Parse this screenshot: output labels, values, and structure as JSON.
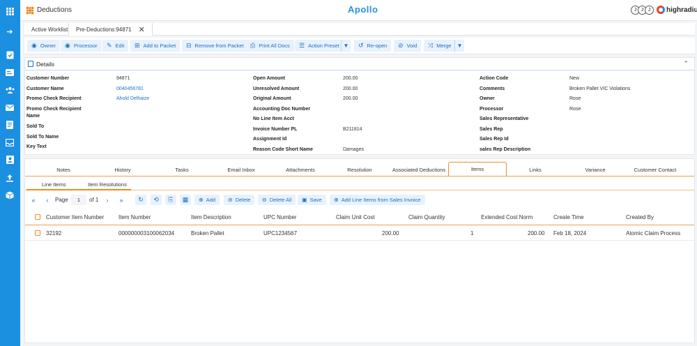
{
  "topbar": {
    "app_title": "Deductions",
    "brand": "Apollo",
    "avatars": [
      "J",
      "J",
      "J"
    ],
    "company": "highradius"
  },
  "sidebar": {
    "icons": [
      "grid-icon",
      "arrow-right-icon",
      "checklist-icon",
      "id-card-icon",
      "users-icon",
      "mail-icon",
      "document-icon",
      "inbox-icon",
      "contact-icon",
      "upload-icon",
      "box-icon"
    ]
  },
  "worklist_tabs": [
    {
      "label": "Active Worklist"
    },
    {
      "label": "Pre-Deductions:94871"
    }
  ],
  "toolbar": {
    "buttons": [
      "Owner",
      "Processor",
      "Edit",
      "Add to Packet",
      "Remove from Packet",
      "Print All Docs",
      "Action Preset",
      "Re-open",
      "Void",
      "Merge"
    ]
  },
  "details": {
    "title": "Details",
    "col1": [
      {
        "label": "Customer Number",
        "value": "94871"
      },
      {
        "label": "Customer Name",
        "value": "0040456781"
      },
      {
        "label": "Promo Check Recipient",
        "value": "Ahold Delhaize"
      },
      {
        "label": "Promo Check Recipient",
        "value": ""
      },
      {
        "label": "Name",
        "value": ""
      },
      {
        "label": "Sold To",
        "value": ""
      },
      {
        "label": "Sold To Name",
        "value": ""
      },
      {
        "label": "Key Text",
        "value": ""
      }
    ],
    "col2": [
      {
        "label": "Open Amount",
        "value": "200.00"
      },
      {
        "label": "Unresolved Amount",
        "value": "200.00"
      },
      {
        "label": "Original Amount",
        "value": "200.00"
      },
      {
        "label": "Accounting Doc Number",
        "value": ""
      },
      {
        "label": "No Line Item Acct",
        "value": ""
      },
      {
        "label": "Invoice Number PL",
        "value": "B211814"
      },
      {
        "label": "Assignment Id",
        "value": ""
      },
      {
        "label": "Reason Code Short Name",
        "value": "Damages"
      }
    ],
    "col3": [
      {
        "label": "Action Code",
        "value": "New"
      },
      {
        "label": "Comments",
        "value": "Broken Pallet VIC Violations"
      },
      {
        "label": "Owner",
        "value": "Rose"
      },
      {
        "label": "Processor",
        "value": "Rose"
      },
      {
        "label": "Sales Representative",
        "value": ""
      },
      {
        "label": "Sales Rep",
        "value": ""
      },
      {
        "label": "Sales Rep Id",
        "value": ""
      },
      {
        "label": "sales Rep Description",
        "value": ""
      }
    ]
  },
  "lower_tabs": [
    "Notes",
    "History",
    "Tasks",
    "Email Inbox",
    "Attachments",
    "Resolution",
    "Associated Deductions",
    "Items",
    "Links",
    "Variance",
    "Customer Contact"
  ],
  "active_lower_tab": "Items",
  "sub_tabs": [
    "Line Items",
    "Item Resolutions"
  ],
  "grid_toolbar": {
    "page_label": "Page",
    "page_value": "1",
    "of_label": "of 1",
    "add": "Add",
    "delete": "Delete",
    "delete_all": "Delete All",
    "save": "Save",
    "add_from_invoice": "Add Line Items from Sales Invoice"
  },
  "table": {
    "columns": [
      "Customer Item Number",
      "Item Number",
      "Item Description",
      "UPC Number",
      "Claim Unit Cost",
      "Claim Quantity",
      "Extended Cost Norm",
      "Create Time",
      "Created By"
    ],
    "rows": [
      [
        "32192",
        "000000003100062034",
        "Broken Pallet",
        "UPC1234567",
        "200.00",
        "1",
        "200.00",
        "Feb 18, 2024",
        "Atomic Claim Process"
      ]
    ]
  }
}
